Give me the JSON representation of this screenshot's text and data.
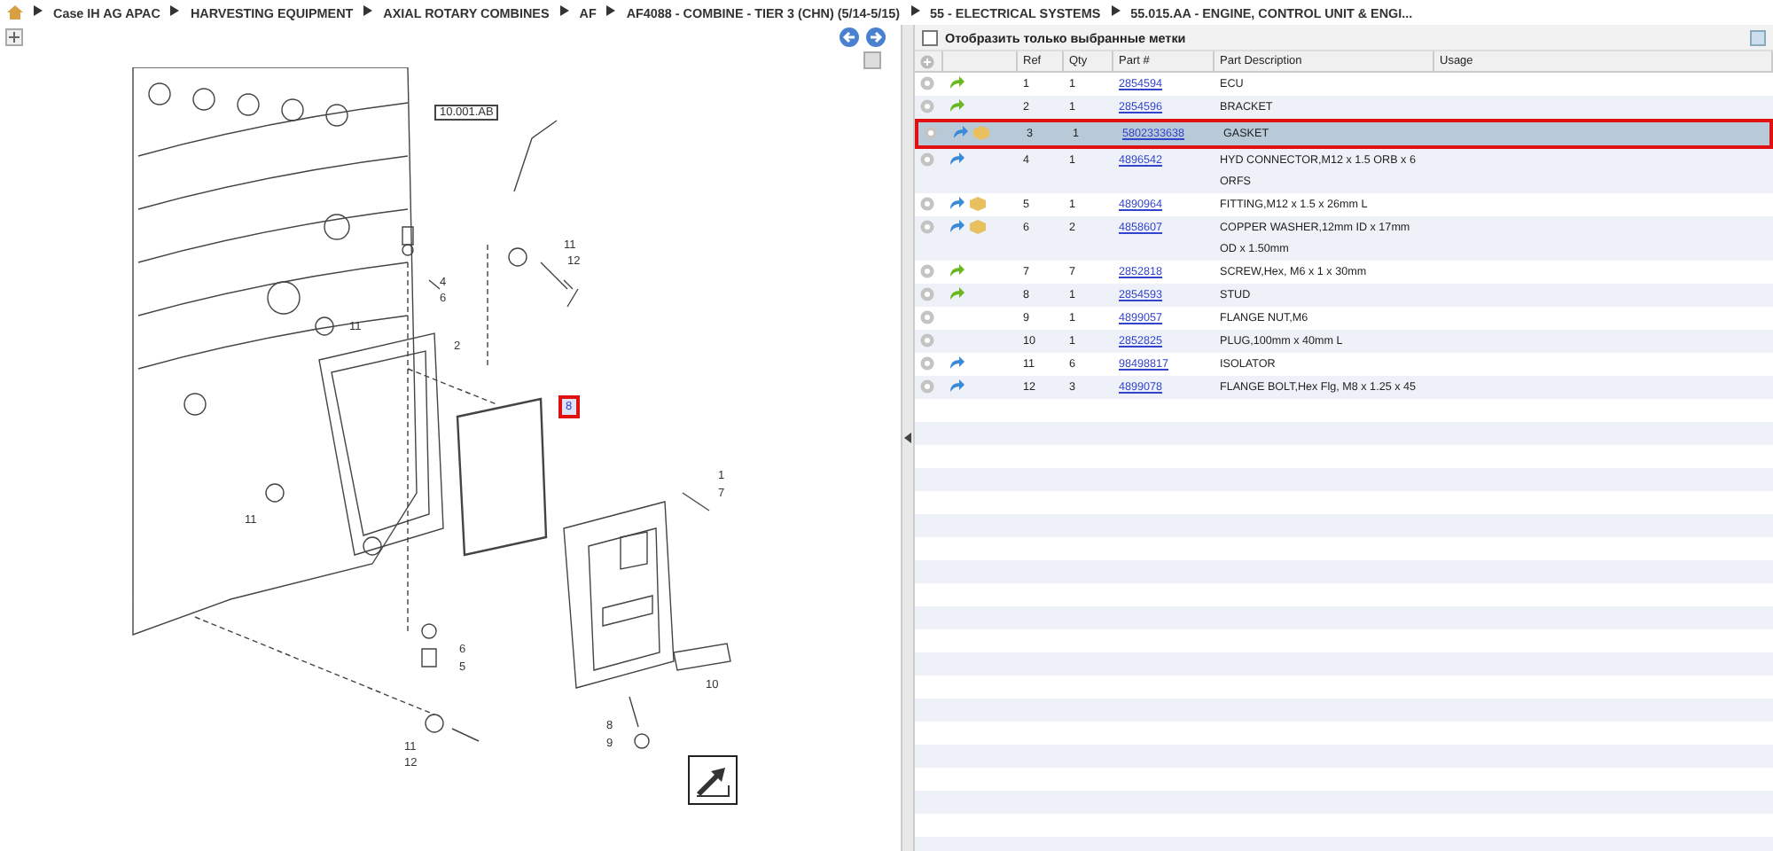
{
  "breadcrumb": [
    "Case IH AG APAC",
    "HARVESTING EQUIPMENT",
    "AXIAL ROTARY COMBINES",
    "AF",
    "AF4088 - COMBINE - TIER 3 (CHN) (5/14-5/15)",
    "55 - ELECTRICAL SYSTEMS",
    "55.015.AA - ENGINE, CONTROL UNIT & ENGI..."
  ],
  "diagram": {
    "callouts": [
      {
        "label": "10.001.AB",
        "selected": false
      },
      {
        "label": "4",
        "selected": false
      },
      {
        "label": "6",
        "selected": false
      },
      {
        "label": "11",
        "selected": false
      },
      {
        "label": "12",
        "selected": false
      },
      {
        "label": "11",
        "selected": false
      },
      {
        "label": "2",
        "selected": false
      },
      {
        "label": "8",
        "selected": true
      },
      {
        "label": "11",
        "selected": false
      },
      {
        "label": "1",
        "selected": false
      },
      {
        "label": "7",
        "selected": false
      },
      {
        "label": "6",
        "selected": false
      },
      {
        "label": "5",
        "selected": false
      },
      {
        "label": "10",
        "selected": false
      },
      {
        "label": "8",
        "selected": false
      },
      {
        "label": "9",
        "selected": false
      },
      {
        "label": "11",
        "selected": false
      },
      {
        "label": "12",
        "selected": false
      }
    ]
  },
  "parts": {
    "filter": {
      "label": "Отобразить только выбранные метки",
      "checked": false
    },
    "columns": [
      "Ref",
      "Qty",
      "Part #",
      "Part Description",
      "Usage"
    ],
    "rows": [
      {
        "ref": "1",
        "qty": "1",
        "part": "2854594",
        "description": "ECU",
        "kind": "green-arrow",
        "box": false,
        "selected": false
      },
      {
        "ref": "2",
        "qty": "1",
        "part": "2854596",
        "description": "BRACKET",
        "kind": "green-arrow",
        "box": false,
        "selected": false
      },
      {
        "ref": "3",
        "qty": "1",
        "part": "5802333638",
        "description": "GASKET",
        "kind": "blue-arrow",
        "box": true,
        "selected": true
      },
      {
        "ref": "4",
        "qty": "1",
        "part": "4896542",
        "description": "HYD CONNECTOR,M12 x 1.5 ORB x 6 ORFS",
        "kind": "blue-arrow",
        "box": false,
        "selected": false
      },
      {
        "ref": "5",
        "qty": "1",
        "part": "4890964",
        "description": "FITTING,M12 x 1.5 x 26mm L",
        "kind": "blue-arrow",
        "box": true,
        "selected": false
      },
      {
        "ref": "6",
        "qty": "2",
        "part": "4858607",
        "description": "COPPER WASHER,12mm ID x 17mm OD x 1.50mm",
        "kind": "blue-arrow",
        "box": true,
        "selected": false
      },
      {
        "ref": "7",
        "qty": "7",
        "part": "2852818",
        "description": "SCREW,Hex, M6 x 1 x 30mm",
        "kind": "green-arrow",
        "box": false,
        "selected": false
      },
      {
        "ref": "8",
        "qty": "1",
        "part": "2854593",
        "description": "STUD",
        "kind": "green-arrow",
        "box": false,
        "selected": false
      },
      {
        "ref": "9",
        "qty": "1",
        "part": "4899057",
        "description": "FLANGE NUT,M6",
        "kind": "plain",
        "box": false,
        "selected": false
      },
      {
        "ref": "10",
        "qty": "1",
        "part": "2852825",
        "description": "PLUG,100mm x 40mm L",
        "kind": "plain",
        "box": false,
        "selected": false
      },
      {
        "ref": "11",
        "qty": "6",
        "part": "98498817",
        "description": "ISOLATOR",
        "kind": "blue-arrow",
        "box": false,
        "selected": false
      },
      {
        "ref": "12",
        "qty": "3",
        "part": "4899078",
        "description": "FLANGE BOLT,Hex Flg, M8 x 1.25 x 45",
        "kind": "blue-arrow",
        "box": false,
        "selected": false
      }
    ]
  }
}
